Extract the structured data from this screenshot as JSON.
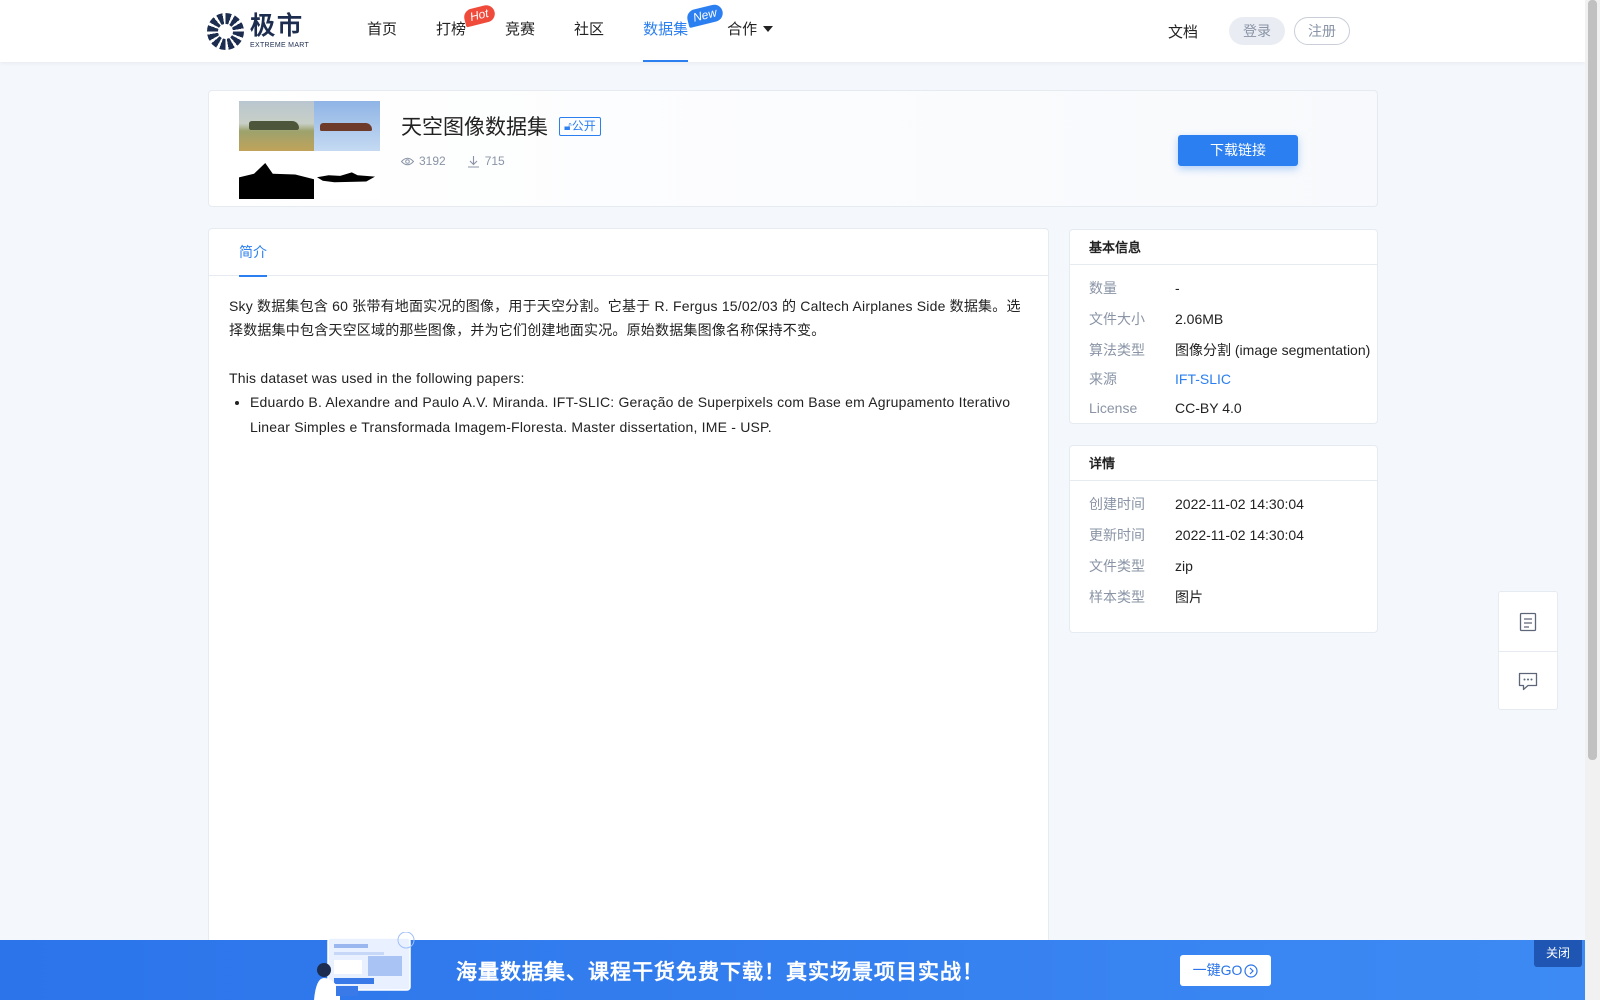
{
  "brand": {
    "name_cn": "极市",
    "name_en": "EXTREME MART"
  },
  "nav": {
    "items": [
      {
        "label": "首页"
      },
      {
        "label": "打榜",
        "badge": "Hot"
      },
      {
        "label": "竞赛"
      },
      {
        "label": "社区"
      },
      {
        "label": "数据集",
        "badge": "New",
        "active": true
      },
      {
        "label": "合作",
        "has_dropdown": true
      }
    ]
  },
  "header_right": {
    "docs": "文档",
    "login": "登录",
    "register": "注册"
  },
  "dataset": {
    "title": "天空图像数据集",
    "visibility": "公开",
    "views": "3192",
    "downloads": "715",
    "download_button": "下载链接"
  },
  "tabs": [
    {
      "label": "简介",
      "active": true
    }
  ],
  "description": {
    "paragraph": "Sky 数据集包含 60 张带有地面实况的图像，用于天空分割。它基于 R. Fergus 15/02/03 的 Caltech Airplanes Side 数据集。选择数据集中包含天空区域的那些图像，并为它们创建地面实况。原始数据集图像名称保持不变。",
    "papers_intro": "This dataset was used in the following papers:",
    "papers": [
      "Eduardo B. Alexandre and Paulo A.V. Miranda. IFT-SLIC: Geração de Superpixels com Base em Agrupamento Iterativo Linear Simples e Transformada Imagem-Floresta. Master dissertation, IME - USP."
    ]
  },
  "basic_info": {
    "title": "基本信息",
    "rows": [
      {
        "key": "数量",
        "value": "-"
      },
      {
        "key": "文件大小",
        "value": "2.06MB"
      },
      {
        "key": "算法类型",
        "value": "图像分割 (image segmentation)"
      },
      {
        "key": "来源",
        "value": "IFT-SLIC"
      },
      {
        "key": "License",
        "value": "CC-BY 4.0"
      }
    ]
  },
  "details": {
    "title": "详情",
    "rows": [
      {
        "key": "创建时间",
        "value": "2022-11-02 14:30:04"
      },
      {
        "key": "更新时间",
        "value": "2022-11-02 14:30:04"
      },
      {
        "key": "文件类型",
        "value": "zip"
      },
      {
        "key": "样本类型",
        "value": "图片"
      }
    ]
  },
  "banner": {
    "text": "海量数据集、课程干货免费下载！真实场景项目实战！",
    "go_button": "一键GO",
    "close": "关闭"
  },
  "colors": {
    "accent": "#2b7ff0",
    "hot_badge": "#ef4a3a",
    "banner": "#2b74ea"
  },
  "icons": [
    "eye-icon",
    "download-icon",
    "document-icon",
    "chat-icon",
    "arrow-circle-icon"
  ]
}
